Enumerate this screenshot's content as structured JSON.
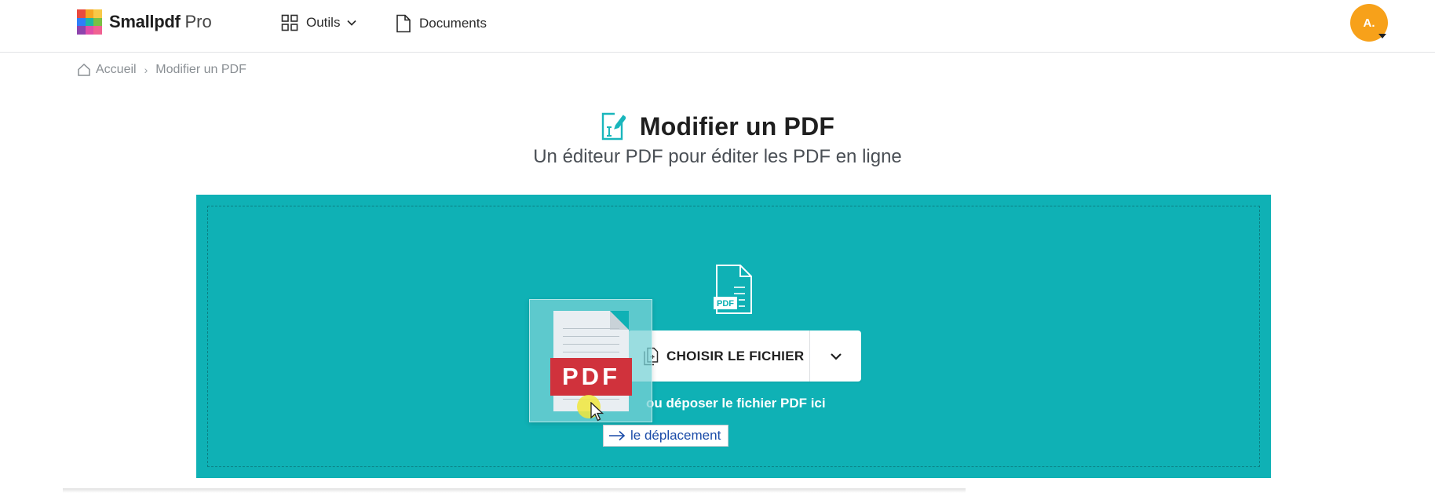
{
  "header": {
    "brand": "Smallpdf",
    "brand_tier": "Pro",
    "nav": {
      "tools_label": "Outils",
      "documents_label": "Documents"
    },
    "avatar_initials": "A."
  },
  "breadcrumb": {
    "home_label": "Accueil",
    "separator": "›",
    "current_label": "Modifier un PDF"
  },
  "page": {
    "title": "Modifier un PDF",
    "subtitle": "Un éditeur PDF pour éditer les PDF en ligne"
  },
  "dropzone": {
    "file_badge": "PDF",
    "choose_button_label": "CHOISIR LE FICHIER",
    "drop_hint": "ou déposer le fichier PDF ici"
  },
  "drag": {
    "ghost_label": "PDF",
    "tooltip": "le déplacement"
  },
  "colors": {
    "accent_teal": "#0fb1b5",
    "avatar_orange": "#f7a11a",
    "pdf_red": "#d0323c",
    "title_icon_teal": "#19b6bc"
  },
  "icons": {
    "tools": "grid-icon",
    "documents": "document-icon",
    "home": "home-icon",
    "title": "edit-pdf-icon",
    "file": "pdf-file-icon",
    "choose": "add-file-icon",
    "dropdown": "chevron-down-icon"
  }
}
